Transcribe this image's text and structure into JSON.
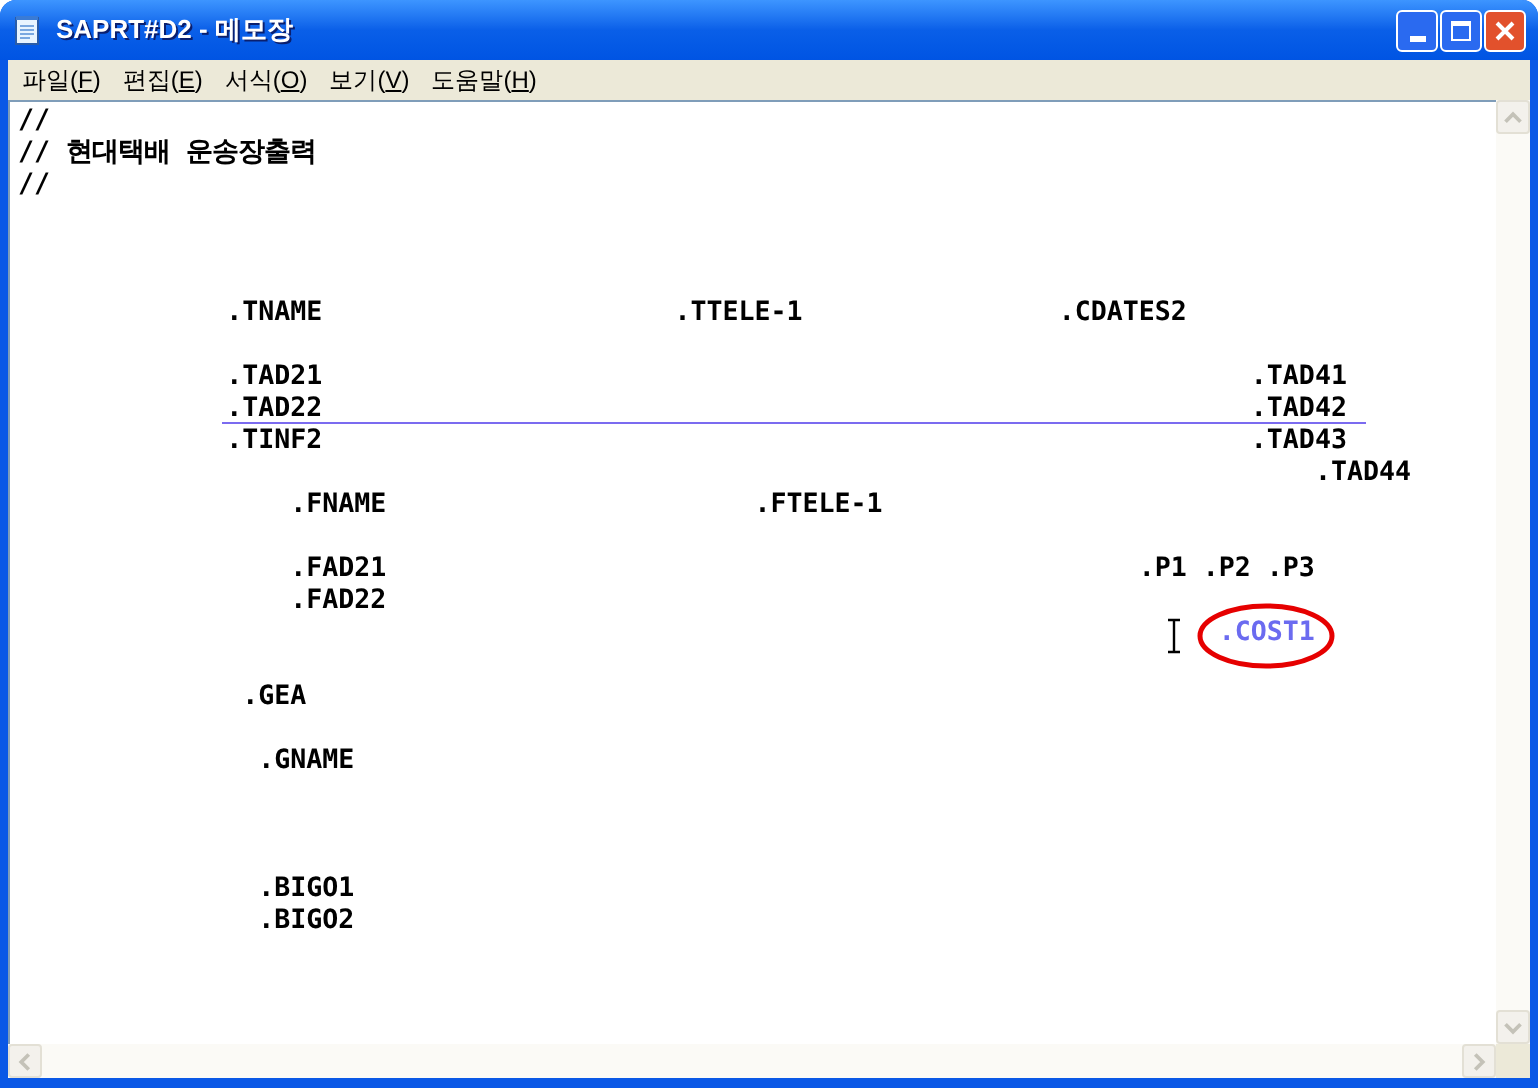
{
  "window": {
    "title": "SAPRT#D2 - 메모장"
  },
  "menu": [
    {
      "label": "파일(F)"
    },
    {
      "label": "편집(E)"
    },
    {
      "label": "서식(O)"
    },
    {
      "label": "보기(V)"
    },
    {
      "label": "도움말(H)"
    }
  ],
  "document": {
    "lines": [
      {
        "kind": "text",
        "text": "//"
      },
      {
        "kind": "text",
        "text": "// 현대택배 운송장출력"
      },
      {
        "kind": "text",
        "text": "//"
      },
      {
        "kind": "blank"
      },
      {
        "kind": "blank"
      },
      {
        "kind": "blank"
      },
      {
        "kind": "text",
        "text": "             .TNAME                      .TTELE-1                .CDATES2"
      },
      {
        "kind": "blank"
      },
      {
        "kind": "text",
        "text": "             .TAD21                                                          .TAD41"
      },
      {
        "kind": "text",
        "text": "             .TAD22                                                          .TAD42",
        "marked": true
      },
      {
        "kind": "text",
        "text": "             .TINF2                                                          .TAD43"
      },
      {
        "kind": "text",
        "text": "                                                                                 .TAD44"
      },
      {
        "kind": "text",
        "text": "                 .FNAME                       .FTELE-1"
      },
      {
        "kind": "blank"
      },
      {
        "kind": "text",
        "text": "                 .FAD21                                               .P1 .P2 .P3"
      },
      {
        "kind": "text",
        "text": "                 .FAD22"
      },
      {
        "kind": "text",
        "text": "                                                                           .COST1",
        "color": "#6b6bf0",
        "circled": true,
        "cursor": true
      },
      {
        "kind": "blank"
      },
      {
        "kind": "text",
        "text": "              .GEA"
      },
      {
        "kind": "blank"
      },
      {
        "kind": "text",
        "text": "               .GNAME"
      },
      {
        "kind": "blank"
      },
      {
        "kind": "blank"
      },
      {
        "kind": "blank"
      },
      {
        "kind": "text",
        "text": "               .BIGO1"
      },
      {
        "kind": "text",
        "text": "               .BIGO2"
      }
    ]
  }
}
